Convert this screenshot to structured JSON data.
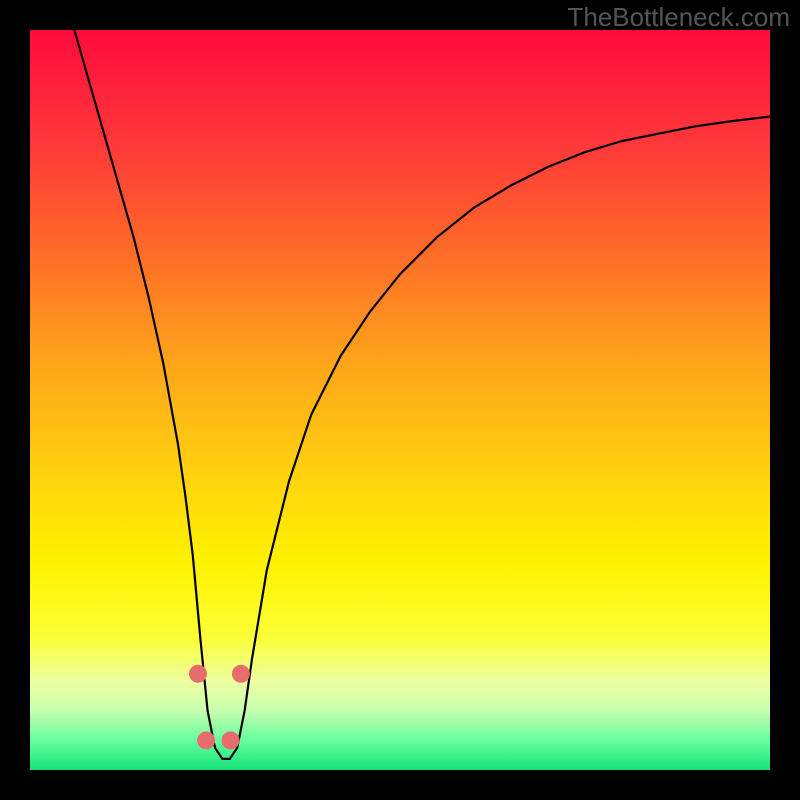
{
  "watermark": "TheBottleneck.com",
  "chart_data": {
    "type": "line",
    "title": "",
    "xlabel": "",
    "ylabel": "",
    "xlim": [
      0,
      100
    ],
    "ylim": [
      0,
      100
    ],
    "grid": false,
    "legend": false,
    "background_gradient_stops": [
      {
        "offset": 0.0,
        "color": "#ff0b3c"
      },
      {
        "offset": 0.15,
        "color": "#ff373a"
      },
      {
        "offset": 0.3,
        "color": "#ff6b29"
      },
      {
        "offset": 0.45,
        "color": "#ffa51a"
      },
      {
        "offset": 0.6,
        "color": "#ffd20f"
      },
      {
        "offset": 0.72,
        "color": "#fff200"
      },
      {
        "offset": 0.82,
        "color": "#fbff35"
      },
      {
        "offset": 0.88,
        "color": "#eeffa0"
      },
      {
        "offset": 0.92,
        "color": "#c7ffb0"
      },
      {
        "offset": 0.96,
        "color": "#66ff9d"
      },
      {
        "offset": 1.0,
        "color": "#16e47a"
      }
    ],
    "series": [
      {
        "name": "bottleneck-curve",
        "color": "#000000",
        "x": [
          6,
          8,
          10,
          12,
          14,
          16,
          18,
          20,
          21,
          22,
          23,
          24,
          25,
          26,
          27,
          28,
          29,
          30,
          32,
          35,
          38,
          42,
          46,
          50,
          55,
          60,
          65,
          70,
          75,
          80,
          85,
          90,
          95,
          100
        ],
        "y": [
          100,
          93,
          86,
          79,
          72,
          64,
          55,
          44,
          37,
          29,
          18,
          8,
          3,
          1.5,
          1.5,
          3,
          8,
          15,
          27,
          39,
          48,
          56,
          62,
          67,
          72,
          76,
          79,
          81.5,
          83.5,
          85,
          86,
          87,
          87.7,
          88.3
        ]
      }
    ],
    "markers": {
      "color": "#e76d6c",
      "radius_px": 9,
      "points": [
        {
          "x": 22.7,
          "y": 13
        },
        {
          "x": 23.8,
          "y": 4
        },
        {
          "x": 27.1,
          "y": 4
        },
        {
          "x": 28.5,
          "y": 13
        }
      ]
    }
  }
}
